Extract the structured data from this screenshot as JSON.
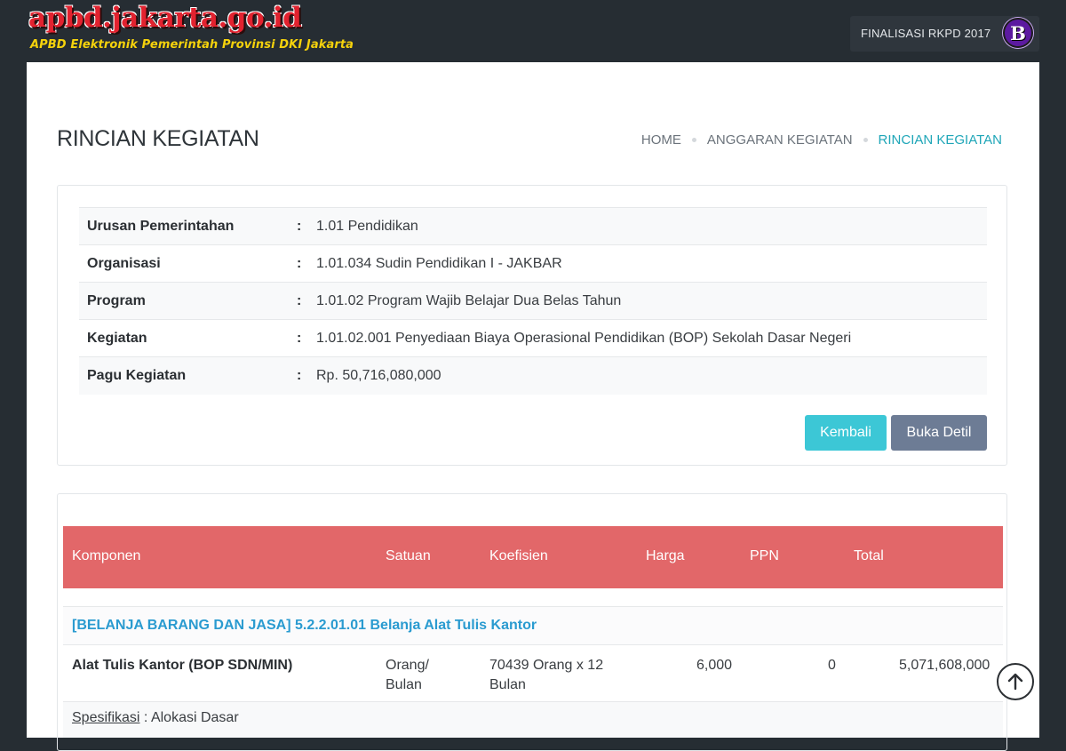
{
  "header": {
    "site_title": "apbd.jakarta.go.id",
    "site_subtitle": "APBD Elektronik Pemerintah Provinsi DKI Jakarta",
    "finalisasi_label": "FINALISASI RKPD 2017",
    "badge_letter": "B"
  },
  "page": {
    "title": "RINCIAN KEGIATAN",
    "breadcrumb": [
      "HOME",
      "ANGGARAN KEGIATAN",
      "RINCIAN KEGIATAN"
    ]
  },
  "info": {
    "rows": [
      {
        "label": "Urusan Pemerintahan",
        "colon": ":",
        "value": "1.01 Pendidikan"
      },
      {
        "label": "Organisasi",
        "colon": ":",
        "value": "1.01.034 Sudin Pendidikan I - JAKBAR"
      },
      {
        "label": "Program",
        "colon": ":",
        "value": "1.01.02 Program Wajib Belajar Dua Belas Tahun"
      },
      {
        "label": "Kegiatan",
        "colon": ":",
        "value": "1.01.02.001 Penyediaan Biaya Operasional Pendidikan (BOP) Sekolah Dasar Negeri"
      },
      {
        "label": "Pagu Kegiatan",
        "colon": ":",
        "value": "Rp. 50,716,080,000"
      }
    ],
    "buttons": {
      "kembali": "Kembali",
      "buka_detil": "Buka Detil"
    }
  },
  "table": {
    "headers": [
      "Komponen",
      "Satuan",
      "Koefisien",
      "Harga",
      "PPN",
      "Total"
    ],
    "group": "[BELANJA BARANG DAN JASA] 5.2.2.01.01 Belanja Alat Tulis Kantor",
    "item": {
      "komponen": "Alat Tulis Kantor (BOP SDN/MIN)",
      "satuan_1": "Orang/",
      "satuan_2": "Bulan",
      "koefisien_1": "70439 Orang x 12",
      "koefisien_2": "Bulan",
      "harga": "6,000",
      "ppn": "0",
      "total": "5,071,608,000"
    },
    "spec_label": "Spesifikasi",
    "spec_value": " : Alokasi Dasar"
  },
  "colors": {
    "header_bg": "#262d33",
    "table_head": "#e26769",
    "accent_teal": "#3cc7d6",
    "button_slate": "#6d7c95",
    "link_blue": "#2a9bd0"
  },
  "icons": {
    "scroll_top": "arrow-up-circle-icon"
  }
}
